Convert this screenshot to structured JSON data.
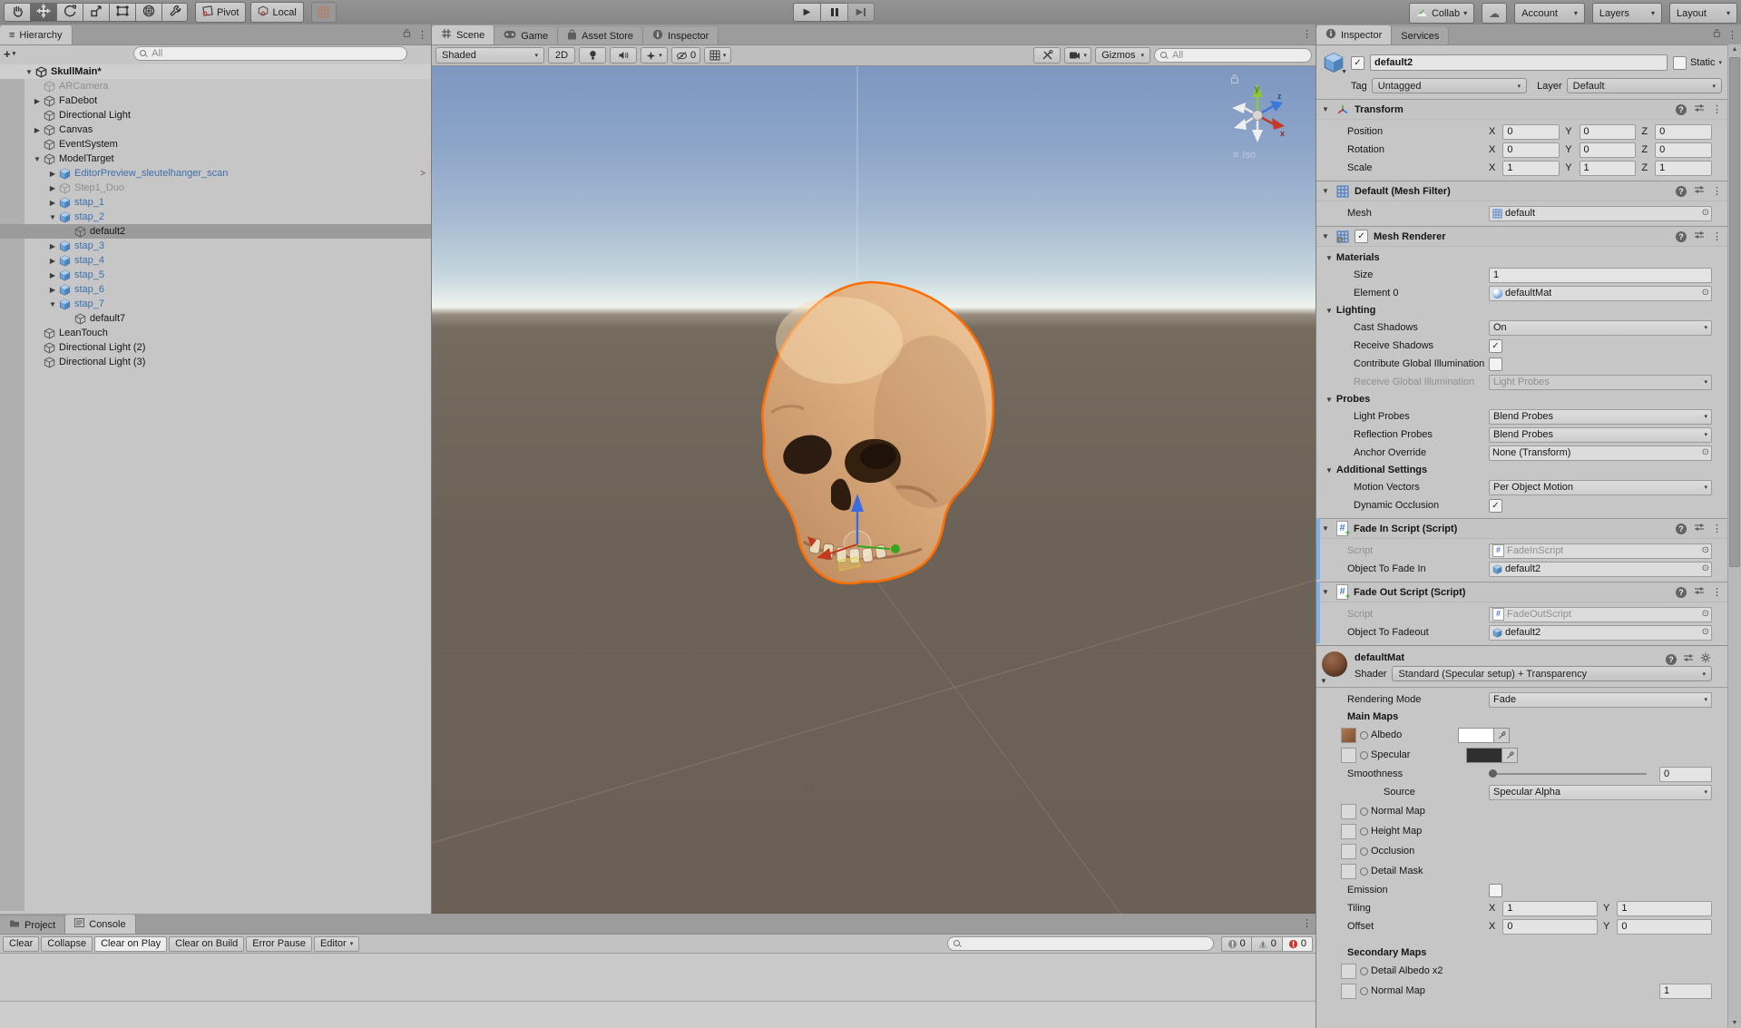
{
  "toolbar": {
    "tools": [
      "hand-tool",
      "move-tool",
      "rotate-tool",
      "scale-tool",
      "rect-tool",
      "transform-tool",
      "custom-tools"
    ],
    "active_tool_index": 1,
    "pivot_label": "Pivot",
    "local_label": "Local",
    "play_label": "play",
    "pause_label": "pause",
    "step_label": "step",
    "collab_label": "Collab",
    "account_label": "Account",
    "layers_label": "Layers",
    "layout_label": "Layout"
  },
  "hierarchy": {
    "tab_label": "Hierarchy",
    "search_placeholder": "All",
    "items": [
      {
        "label": "SkullMain*",
        "depth": 0,
        "arrow": "down",
        "icon": "scene",
        "style": "scene"
      },
      {
        "label": "ARCamera",
        "depth": 1,
        "arrow": "none",
        "icon": "cube",
        "style": "disabled"
      },
      {
        "label": "FaDebot",
        "depth": 1,
        "arrow": "right",
        "icon": "cube",
        "style": "normal"
      },
      {
        "label": "Directional Light",
        "depth": 1,
        "arrow": "none",
        "icon": "cube",
        "style": "normal"
      },
      {
        "label": "Canvas",
        "depth": 1,
        "arrow": "right",
        "icon": "cube",
        "style": "normal"
      },
      {
        "label": "EventSystem",
        "depth": 1,
        "arrow": "none",
        "icon": "cube",
        "style": "normal"
      },
      {
        "label": "ModelTarget",
        "depth": 1,
        "arrow": "down",
        "icon": "cube",
        "style": "normal"
      },
      {
        "label": "EditorPreview_sleutelhanger_scan",
        "depth": 2,
        "arrow": "right",
        "icon": "prefab",
        "style": "prefab",
        "nav": true
      },
      {
        "label": "Step1_Duo",
        "depth": 2,
        "arrow": "right",
        "icon": "cube",
        "style": "disabled"
      },
      {
        "label": "stap_1",
        "depth": 2,
        "arrow": "right",
        "icon": "prefab",
        "style": "prefab"
      },
      {
        "label": "stap_2",
        "depth": 2,
        "arrow": "down",
        "icon": "prefab",
        "style": "prefab"
      },
      {
        "label": "default2",
        "depth": 3,
        "arrow": "none",
        "icon": "cube",
        "style": "selected"
      },
      {
        "label": "stap_3",
        "depth": 2,
        "arrow": "right",
        "icon": "prefab",
        "style": "prefab"
      },
      {
        "label": "stap_4",
        "depth": 2,
        "arrow": "right",
        "icon": "prefab",
        "style": "prefab"
      },
      {
        "label": "stap_5",
        "depth": 2,
        "arrow": "right",
        "icon": "prefab",
        "style": "prefab"
      },
      {
        "label": "stap_6",
        "depth": 2,
        "arrow": "right",
        "icon": "prefab",
        "style": "prefab"
      },
      {
        "label": "stap_7",
        "depth": 2,
        "arrow": "down",
        "icon": "prefab",
        "style": "prefab"
      },
      {
        "label": "default7",
        "depth": 3,
        "arrow": "none",
        "icon": "cube",
        "style": "normal"
      },
      {
        "label": "LeanTouch",
        "depth": 1,
        "arrow": "none",
        "icon": "cube",
        "style": "normal"
      },
      {
        "label": "Directional Light (2)",
        "depth": 1,
        "arrow": "none",
        "icon": "cube",
        "style": "normal"
      },
      {
        "label": "Directional Light (3)",
        "depth": 1,
        "arrow": "none",
        "icon": "cube",
        "style": "normal"
      }
    ]
  },
  "scene": {
    "tabs": [
      {
        "label": "Scene",
        "icon": "scene-grid-icon",
        "active": true
      },
      {
        "label": "Game",
        "icon": "game-icon",
        "active": false
      },
      {
        "label": "Asset Store",
        "icon": "bag-icon",
        "active": false
      },
      {
        "label": "Inspector",
        "icon": "info-icon",
        "active": false
      }
    ],
    "shading_mode": "Shaded",
    "toggle_2d_label": "2D",
    "hidden_count": "0",
    "gizmos_label": "Gizmos",
    "search_placeholder": "All",
    "view_mode_label": "Iso",
    "axis_labels": {
      "x": "x",
      "y": "y",
      "z": "z"
    }
  },
  "inspector": {
    "tabs": [
      {
        "label": "Inspector",
        "icon": "info-icon",
        "active": true
      },
      {
        "label": "Services",
        "icon": "none",
        "active": false
      }
    ],
    "gameobject": {
      "name": "default2",
      "active": true,
      "static_label": "Static",
      "tag_label": "Tag",
      "tag_value": "Untagged",
      "layer_label": "Layer",
      "layer_value": "Default"
    },
    "components": [
      {
        "title": "Transform",
        "icon": "transform-icon",
        "rows": [
          {
            "type": "vec3",
            "label": "Position",
            "x": "0",
            "y": "0",
            "z": "0"
          },
          {
            "type": "vec3",
            "label": "Rotation",
            "x": "0",
            "y": "0",
            "z": "0"
          },
          {
            "type": "vec3",
            "label": "Scale",
            "x": "1",
            "y": "1",
            "z": "1"
          }
        ]
      },
      {
        "title": "Default (Mesh Filter)",
        "icon": "mesh-filter-icon",
        "rows": [
          {
            "type": "object",
            "label": "Mesh",
            "value": "default",
            "icon": "mesh-icon"
          }
        ]
      },
      {
        "title": "Mesh Renderer",
        "icon": "mesh-renderer-icon",
        "checkbox": true,
        "rows": [
          {
            "type": "foldout",
            "label": "Materials"
          },
          {
            "type": "field",
            "label": "Size",
            "value": "1",
            "indent": 1
          },
          {
            "type": "object",
            "label": "Element 0",
            "value": "defaultMat",
            "icon": "material-icon",
            "indent": 1
          },
          {
            "type": "foldout",
            "label": "Lighting"
          },
          {
            "type": "dropdown",
            "label": "Cast Shadows",
            "value": "On",
            "indent": 1
          },
          {
            "type": "checkbox",
            "label": "Receive Shadows",
            "checked": true,
            "indent": 1
          },
          {
            "type": "checkbox",
            "label": "Contribute Global Illumination",
            "checked": false,
            "indent": 1
          },
          {
            "type": "dropdown",
            "label": "Receive Global Illumination",
            "value": "Light Probes",
            "disabled": true,
            "indent": 1
          },
          {
            "type": "foldout",
            "label": "Probes"
          },
          {
            "type": "dropdown",
            "label": "Light Probes",
            "value": "Blend Probes",
            "indent": 1
          },
          {
            "type": "dropdown",
            "label": "Reflection Probes",
            "value": "Blend Probes",
            "indent": 1
          },
          {
            "type": "object",
            "label": "Anchor Override",
            "value": "None (Transform)",
            "icon": "none",
            "indent": 1
          },
          {
            "type": "foldout",
            "label": "Additional Settings"
          },
          {
            "type": "dropdown",
            "label": "Motion Vectors",
            "value": "Per Object Motion",
            "indent": 1
          },
          {
            "type": "checkbox",
            "label": "Dynamic Occlusion",
            "checked": true,
            "indent": 1
          }
        ]
      },
      {
        "title": "Fade In Script (Script)",
        "icon": "script-icon",
        "modified": true,
        "rows": [
          {
            "type": "object",
            "label": "Script",
            "value": "FadeInScript",
            "icon": "script-icon",
            "disabled": true
          },
          {
            "type": "object",
            "label": "Object To Fade In",
            "value": "default2",
            "icon": "prefab-icon"
          }
        ]
      },
      {
        "title": "Fade Out Script (Script)",
        "icon": "script-icon",
        "modified": true,
        "rows": [
          {
            "type": "object",
            "label": "Script",
            "value": "FadeOutScript",
            "icon": "script-icon",
            "disabled": true
          },
          {
            "type": "object",
            "label": "Object To Fadeout",
            "value": "default2",
            "icon": "prefab-icon"
          }
        ]
      }
    ],
    "material": {
      "name": "defaultMat",
      "shader_label": "Shader",
      "shader_value": "Standard (Specular setup) + Transparency",
      "rows": [
        {
          "type": "dropdown",
          "label": "Rendering Mode",
          "value": "Fade",
          "indent": 0
        },
        {
          "type": "bold",
          "label": "Main Maps"
        },
        {
          "type": "map",
          "label": "Albedo",
          "thumb": "albedo",
          "swatch": "#FFFFFF"
        },
        {
          "type": "map",
          "label": "Specular",
          "thumb": "empty",
          "swatch": "#2F2F2F"
        },
        {
          "type": "slider",
          "label": "Smoothness",
          "value": "0"
        },
        {
          "type": "dropdown",
          "label": "Source",
          "value": "Specular Alpha",
          "indent": 3
        },
        {
          "type": "map",
          "label": "Normal Map",
          "thumb": "empty"
        },
        {
          "type": "map",
          "label": "Height Map",
          "thumb": "empty"
        },
        {
          "type": "map",
          "label": "Occlusion",
          "thumb": "empty"
        },
        {
          "type": "map",
          "label": "Detail Mask",
          "thumb": "empty"
        },
        {
          "type": "checkbox",
          "label": "Emission",
          "checked": false
        },
        {
          "type": "vec2",
          "label": "Tiling",
          "x": "1",
          "y": "1"
        },
        {
          "type": "vec2",
          "label": "Offset",
          "x": "0",
          "y": "0"
        },
        {
          "type": "gap"
        },
        {
          "type": "bold",
          "label": "Secondary Maps"
        },
        {
          "type": "map",
          "label": "Detail Albedo x2",
          "thumb": "empty"
        },
        {
          "type": "map",
          "label": "Normal Map",
          "thumb": "empty",
          "field": "1"
        }
      ]
    }
  },
  "console": {
    "tabs": [
      {
        "label": "Project",
        "icon": "project-icon",
        "active": false
      },
      {
        "label": "Console",
        "icon": "console-icon",
        "active": true
      }
    ],
    "buttons": [
      {
        "label": "Clear",
        "active": false
      },
      {
        "label": "Collapse",
        "active": false
      },
      {
        "label": "Clear on Play",
        "active": true
      },
      {
        "label": "Clear on Build",
        "active": false
      },
      {
        "label": "Error Pause",
        "active": false
      }
    ],
    "editor_dropdown_label": "Editor",
    "info_count": "0",
    "warning_count": "0",
    "error_count": "0"
  },
  "colors": {
    "selection_gray": "#9B9B9B",
    "prefab_blue": "#3E6FAE",
    "outline_orange": "#FF6E00",
    "modified_bar_blue": "#7FB3E8"
  }
}
